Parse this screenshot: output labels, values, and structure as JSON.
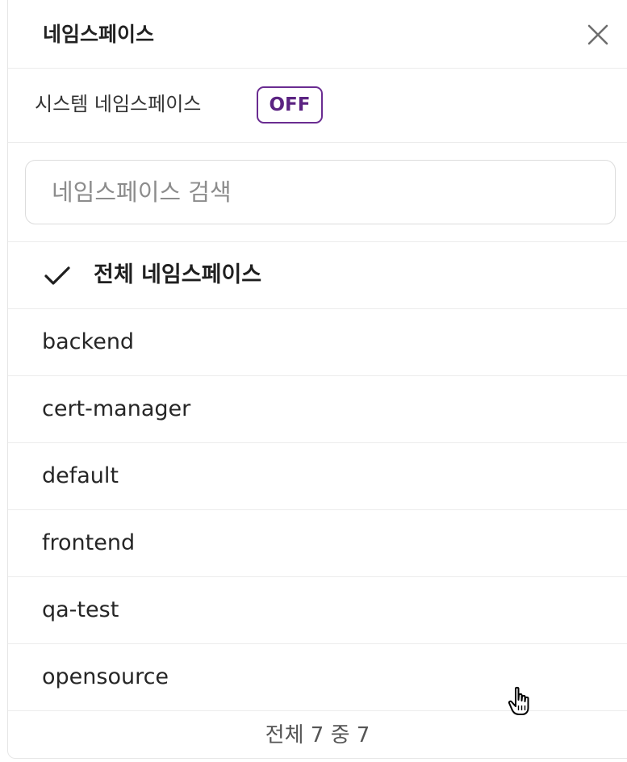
{
  "header": {
    "title": "네임스페이스",
    "close_icon": "close-icon"
  },
  "system_toggle": {
    "label": "시스템 네임스페이스",
    "state": "OFF",
    "accent_color": "#6a2c91"
  },
  "search": {
    "placeholder": "네임스페이스 검색",
    "value": ""
  },
  "list": {
    "all_item": {
      "label": "전체 네임스페이스",
      "selected": true,
      "icon": "check-icon"
    },
    "items": [
      {
        "label": "backend"
      },
      {
        "label": "cert-manager"
      },
      {
        "label": "default"
      },
      {
        "label": "frontend"
      },
      {
        "label": "qa-test"
      },
      {
        "label": "opensource"
      }
    ]
  },
  "footer": {
    "count_text": "전체 7 중 7"
  },
  "cursor": {
    "icon": "hand-pointer-icon"
  }
}
